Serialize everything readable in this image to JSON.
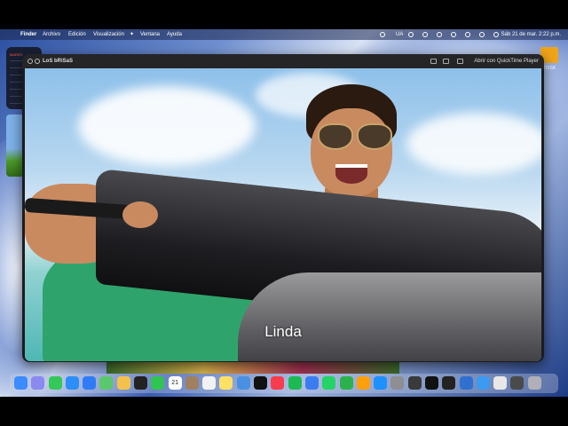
{
  "menubar": {
    "app_name": "Finder",
    "items": [
      "Archivo",
      "Edición",
      "Visualización",
      "Ventana",
      "Ayuda"
    ],
    "right_text": "UA",
    "clock": "Sáb 21 de mar. 2:22 p.m."
  },
  "calendar_widget": {
    "month": "MARZO"
  },
  "desktop": {
    "icon_label": "LLYDISK"
  },
  "player_window": {
    "title": "LoS bRiSaS",
    "open_with_label": "Abrir con QuickTime Player",
    "subtitle": "Linda"
  },
  "dock": {
    "items": [
      "finder-icon",
      "launchpad-icon",
      "messages-icon",
      "safari-icon",
      "mail-icon",
      "maps-icon",
      "photos-icon",
      "chatgpt-icon",
      "facetime-icon",
      "calendar-icon",
      "contacts-icon",
      "reminders-icon",
      "notes-icon",
      "chrome-icon",
      "appletv-icon",
      "music-icon",
      "spotify-icon",
      "files-icon",
      "whatsapp-icon",
      "numbers-icon",
      "pages-icon",
      "appstore-icon",
      "settings-icon",
      "camera-icon",
      "capcut-icon",
      "terminal-icon",
      "screen-icon",
      "preview-icon",
      "folder-icon",
      "downloads-icon",
      "trash-icon"
    ],
    "calendar_day": "21",
    "colors": {
      "finder-icon": "#3d8bff",
      "launchpad-icon": "#8a8af0",
      "messages-icon": "#34c759",
      "safari-icon": "#2c8ef8",
      "mail-icon": "#2f7cf6",
      "maps-icon": "#5ac86b",
      "photos-icon": "#f4c24a",
      "chatgpt-icon": "#222222",
      "facetime-icon": "#30c552",
      "calendar-icon": "#ffffff",
      "contacts-icon": "#a08060",
      "reminders-icon": "#f2f2f2",
      "notes-icon": "#ffe066",
      "chrome-icon": "#4a90e2",
      "appletv-icon": "#111111",
      "music-icon": "#fa3c4c",
      "spotify-icon": "#1db954",
      "files-icon": "#3b7cf0",
      "whatsapp-icon": "#25d366",
      "numbers-icon": "#2cb24d",
      "pages-icon": "#ff9f0a",
      "appstore-icon": "#1e90ff",
      "settings-icon": "#8e8e93",
      "camera-icon": "#3a3a3c",
      "capcut-icon": "#111111",
      "terminal-icon": "#222222",
      "screen-icon": "#3070d0",
      "preview-icon": "#3c9bf0",
      "folder-icon": "#e8e8e8",
      "downloads-icon": "#4a4a4a",
      "trash-icon": "#b0b0b8"
    }
  }
}
